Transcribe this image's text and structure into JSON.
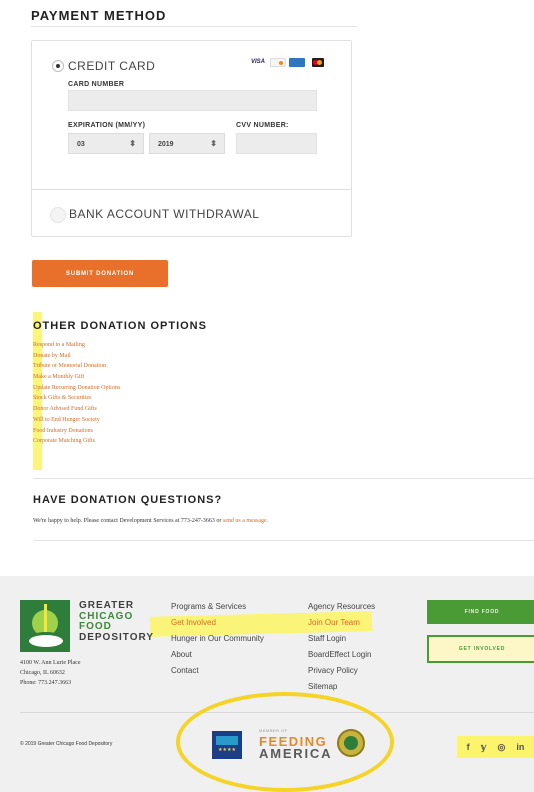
{
  "payment": {
    "title": "PAYMENT METHOD",
    "credit_card_label": "CREDIT CARD",
    "card_number_label": "CARD NUMBER",
    "expiration_label": "EXPIRATION (MM/YY)",
    "cvv_label": "CVV NUMBER:",
    "exp_month": "03",
    "exp_year": "2019",
    "card_logo_visa": "VISA",
    "bank_label": "BANK ACCOUNT WITHDRAWAL",
    "submit_label": "SUBMIT DONATION",
    "select_arrow": "⬍"
  },
  "other_options": {
    "title": "OTHER DONATION OPTIONS",
    "links": [
      "Respond to a Mailing",
      "Donate by Mail",
      "Tribute or Memorial Donation",
      "Make a Monthly Gift",
      "Update Recurring Donation Options",
      "Stock Gifts & Securities",
      "Donor Advised Fund Gifts",
      "Will to End Hunger Society",
      "Food Industry Donations",
      "Corporate Matching Gifts"
    ]
  },
  "questions": {
    "title": "HAVE DONATION QUESTIONS?",
    "text": "We're happy to help. Please contact Development Services at 773-247-3663 or",
    "link": "send us a message."
  },
  "footer": {
    "logo_line1": "GREATER",
    "logo_line2": "CHICAGO",
    "logo_line3": "FOOD",
    "logo_line4": "DEPOSITORY",
    "address_line1": "4100 W. Ann Lurie Place",
    "address_line2": "Chicago, IL 60632",
    "address_line3": "Phone: 773.247.3663",
    "col1": [
      "Programs & Services",
      "Get Involved",
      "Hunger in Our Community",
      "About",
      "Contact"
    ],
    "col2": [
      "Agency Resources",
      "Join Our Team",
      "Staff Login",
      "BoardEffect Login",
      "Privacy Policy",
      "Sitemap"
    ],
    "find_food": "FIND FOOD",
    "get_involved": "GET INVOLVED",
    "copyright": "© 2019 Greater Chicago Food Depository",
    "member_of": "MEMBER OF",
    "feeding": "FEEDING",
    "america": "AMERICA",
    "stars": "★★★★",
    "social": {
      "facebook": "f",
      "twitter": "𝕪",
      "instagram": "◎",
      "linkedin": "in"
    }
  },
  "colors": {
    "accent_orange": "#e8702a",
    "link_orange": "#d96a25",
    "brand_green": "#4a9a35",
    "highlight_yellow": "#fbf46c",
    "circle_yellow": "#f5d327"
  }
}
